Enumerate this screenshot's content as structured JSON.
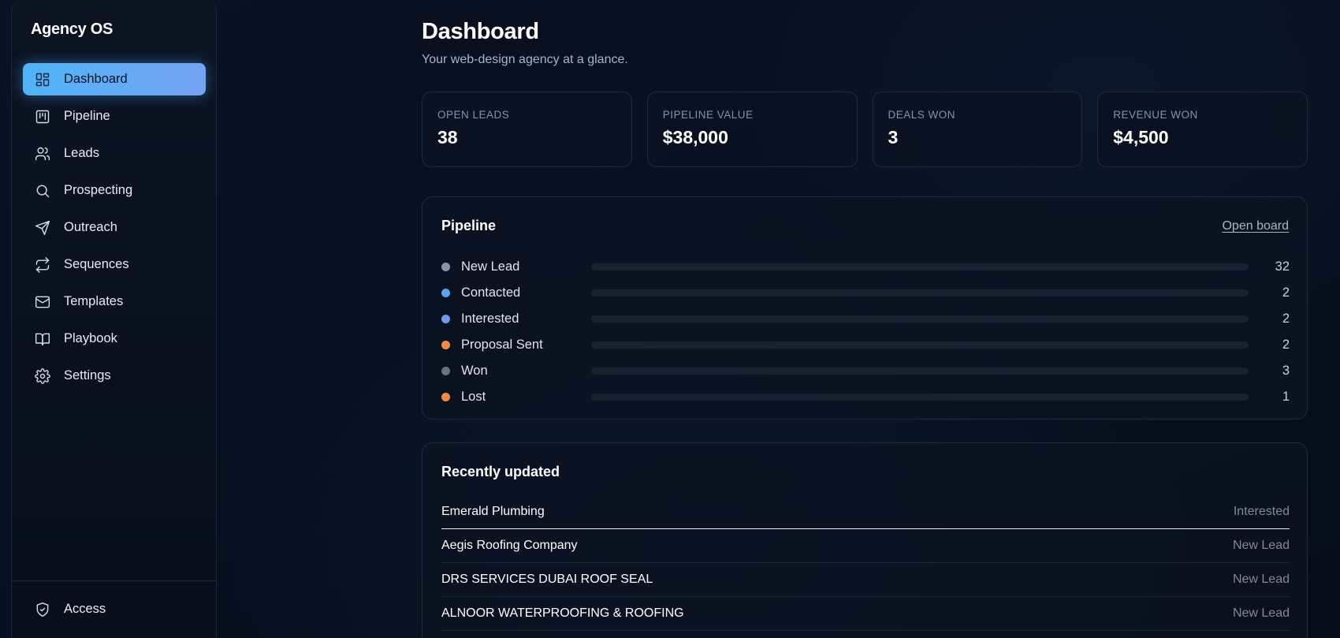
{
  "sidebar": {
    "brand": "Agency OS",
    "items": [
      {
        "label": "Dashboard",
        "icon": "dashboard-grid-icon"
      },
      {
        "label": "Pipeline",
        "icon": "kanban-icon"
      },
      {
        "label": "Leads",
        "icon": "users-icon"
      },
      {
        "label": "Prospecting",
        "icon": "search-icon"
      },
      {
        "label": "Outreach",
        "icon": "send-icon"
      },
      {
        "label": "Sequences",
        "icon": "repeat-icon"
      },
      {
        "label": "Templates",
        "icon": "mail-icon"
      },
      {
        "label": "Playbook",
        "icon": "book-icon"
      },
      {
        "label": "Settings",
        "icon": "gear-icon"
      }
    ],
    "active_item": "Dashboard",
    "footer": {
      "label": "Access",
      "icon": "shield-check-icon"
    }
  },
  "header": {
    "title": "Dashboard",
    "subtitle": "Your web-design agency at a glance."
  },
  "stats": [
    {
      "label": "Open leads",
      "value": "38"
    },
    {
      "label": "Pipeline value",
      "value": "$38,000"
    },
    {
      "label": "Deals won",
      "value": "3"
    },
    {
      "label": "Revenue won",
      "value": "$4,500"
    }
  ],
  "pipeline": {
    "title": "Pipeline",
    "link": "Open board",
    "max": 42,
    "stages": [
      {
        "name": "New Lead",
        "count": "32",
        "value": 32,
        "color": "#8b95a3"
      },
      {
        "name": "Contacted",
        "count": "2",
        "value": 2,
        "color": "#5aa2f0"
      },
      {
        "name": "Interested",
        "count": "2",
        "value": 2,
        "color": "#6b9ce8"
      },
      {
        "name": "Proposal Sent",
        "count": "2",
        "value": 2,
        "color": "#f08a4b"
      },
      {
        "name": "Won",
        "count": "3",
        "value": 3,
        "color": "#677281"
      },
      {
        "name": "Lost",
        "count": "1",
        "value": 1,
        "color": "#f08a4b"
      }
    ]
  },
  "recent": {
    "title": "Recently updated",
    "rows": [
      {
        "name": "Emerald Plumbing",
        "status": "Interested"
      },
      {
        "name": "Aegis Roofing Company",
        "status": "New Lead"
      },
      {
        "name": "DRS SERVICES DUBAI ROOF SEAL",
        "status": "New Lead"
      },
      {
        "name": "ALNOOR WATERPROOFING & ROOFING",
        "status": "New Lead"
      }
    ]
  }
}
